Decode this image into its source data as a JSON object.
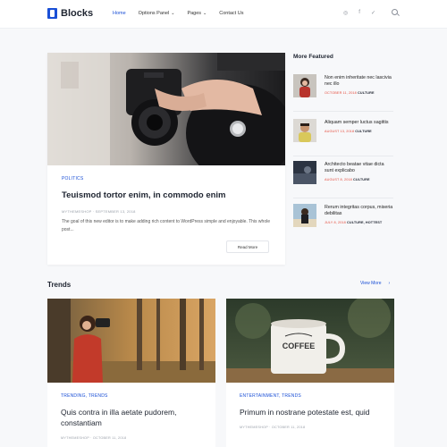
{
  "header": {
    "logo_text": "Blocks",
    "nav": [
      {
        "label": "Home",
        "active": true,
        "dropdown": false
      },
      {
        "label": "Options Panel",
        "active": false,
        "dropdown": true
      },
      {
        "label": "Pages",
        "active": false,
        "dropdown": true
      },
      {
        "label": "Contact Us",
        "active": false,
        "dropdown": false
      }
    ],
    "social_icons": [
      "instagram-icon",
      "facebook-icon",
      "twitter-icon"
    ],
    "accent_color": "#1a4fd6"
  },
  "hero": {
    "category": "POLITICS",
    "title": "Teuismod tortor enim, in commodo enim",
    "meta": "MYTHEMESHOP · SEPTEMBER 13, 2018",
    "excerpt": "The goal of this new editor is to make adding rich content to WordPress simple and enjoyable. This whole post...",
    "read_more": "Read More"
  },
  "sidebar": {
    "title": "More Featured",
    "items": [
      {
        "title": "Non enim inheritate nec lascivia nec illo",
        "date": "OCTOBER 11, 2018",
        "category": "CULTURE",
        "thumb": "woman-portrait"
      },
      {
        "title": "Aliquam semper luctus sagittis",
        "date": "AUGUST 13, 2018",
        "category": "CULTURE",
        "thumb": "man-portrait"
      },
      {
        "title": "Architecto beatae vitae dicta sunt explicabo",
        "date": "AUGUST 8, 2018",
        "category": "CULTURE",
        "thumb": "dark-photo"
      },
      {
        "title": "Rerum integritas corpus, miseria debilitas",
        "date": "JULY 8, 2018",
        "category": "CULTURE, HOTTEST",
        "thumb": "beach-woman"
      }
    ]
  },
  "trends": {
    "title": "Trends",
    "view_more": "View More",
    "cards": [
      {
        "category": "TRENDING, TRENDS",
        "title": "Quis contra in illa aetate pudorem, constantiam",
        "meta": "MYTHEMESHOP · OCTOBER 11, 2018"
      },
      {
        "category": "ENTERTAINMENT, TRENDS",
        "title": "Primum in nostrane potestate est, quid",
        "meta": "MYTHEMESHOP · OCTOBER 11, 2018"
      }
    ]
  }
}
